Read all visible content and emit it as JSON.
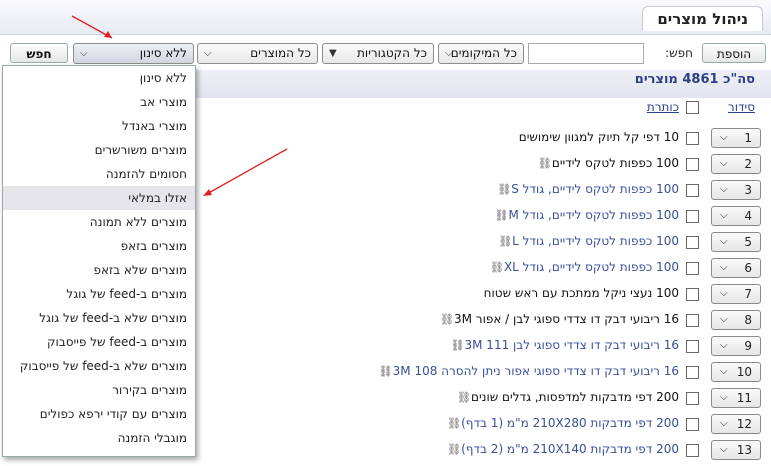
{
  "page": {
    "title": "ניהול מוצרים"
  },
  "toolbar": {
    "add_product": "הוספת מוצר",
    "search_label": "חפש:",
    "search_button": "חפש",
    "search_value": "",
    "locations_select": "כל המיקומים",
    "categories_select": "כל הקטגוריות",
    "products_select": "כל המוצרים",
    "filter_select": "ללא סינון"
  },
  "summary": "סה\"כ 4861 מוצרים",
  "headers": {
    "sort": "סידור",
    "title": "כותרת"
  },
  "filter_menu": [
    "ללא סינון",
    "מוצרי אב",
    "מוצרי באנדל",
    "מוצרים משורשרים",
    "חסומים להזמנה",
    "אזלו במלאי",
    "מוצרים ללא תמונה",
    "מוצרים בזאפ",
    "מוצרים שלא בזאפ",
    "מוצרים ב-feed של גוגל",
    "מוצרים שלא ב-feed של גוגל",
    "מוצרים ב-feed של פייסבוק",
    "מוצרים שלא ב-feed של פייסבוק",
    "מוצרים בקירור",
    "מוצרים עם קודי ירפא כפולים",
    "מוגבלי הזמנה"
  ],
  "rows": [
    {
      "n": "1",
      "name": "10 דפי קל תיוק למגוון שימושים",
      "linked": false,
      "style": "dark"
    },
    {
      "n": "2",
      "name": "100 כפפות לטקס לידיים",
      "linked": true,
      "style": "dark"
    },
    {
      "n": "3",
      "name": "100 כפפות לטקס לידיים, גודל S",
      "linked": true,
      "style": "blue"
    },
    {
      "n": "4",
      "name": "100 כפפות לטקס לידיים, גודל M",
      "linked": true,
      "style": "blue"
    },
    {
      "n": "5",
      "name": "100 כפפות לטקס לידיים, גודל L",
      "linked": true,
      "style": "blue"
    },
    {
      "n": "6",
      "name": "100 כפפות לטקס לידיים, גודל XL",
      "linked": true,
      "style": "blue"
    },
    {
      "n": "7",
      "name": "100 נעצי ניקל ממתכת עם ראש שטוח",
      "linked": false,
      "style": "dark"
    },
    {
      "n": "8",
      "name": "16 ריבועי דבק דו צדדי ספוגי לבן / אפור 3M",
      "linked": true,
      "style": "dark"
    },
    {
      "n": "9",
      "name": "16 ריבועי דבק דו צדדי ספוגי לבן 3M 111",
      "linked": true,
      "style": "blue"
    },
    {
      "n": "10",
      "name": "16 ריבועי דבק דו צדדי ספוגי אפור ניתן להסרה 3M 108",
      "linked": true,
      "style": "blue"
    },
    {
      "n": "11",
      "name": "200 דפי מדבקות למדפסות, גדלים שונים",
      "linked": true,
      "style": "dark"
    },
    {
      "n": "12",
      "name": "200 דפי מדבקות 210X280 מ\"מ (1 בדף)",
      "linked": true,
      "style": "blue"
    },
    {
      "n": "13",
      "name": "200 דפי מדבקות 210X140 מ\"מ (2 בדף)",
      "linked": true,
      "style": "blue"
    }
  ],
  "colors": {
    "accent": "#2e3f86",
    "link": "#3a4f9a",
    "annotation_arrow": "#e02020"
  }
}
